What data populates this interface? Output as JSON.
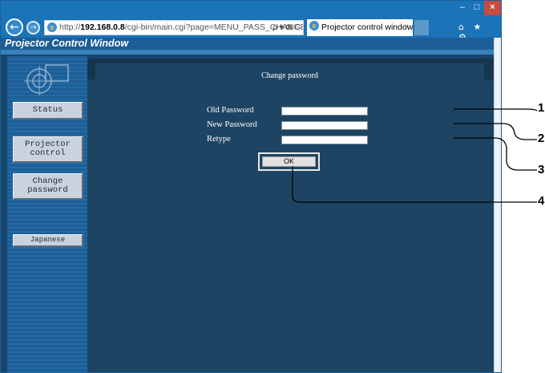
{
  "browser": {
    "url_prefix": "http://",
    "url_host": "192.168.0.8",
    "url_path": "/cgi-bin/main.cgi?page=MENU_PASS_CHANGE&lang=e",
    "address_tools": "ρ ▾ ⊠ C",
    "tab_title": "Projector control window",
    "tab_close": "×",
    "window_controls": [
      "–",
      "□",
      "×"
    ],
    "toolbar_icons": "⌂ ★ ⚙"
  },
  "page": {
    "header_title": "Projector Control Window",
    "sidebar": {
      "status_label": "Status",
      "projector_control_label": "Projector\ncontrol",
      "change_password_label": "Change\npassword",
      "japanese_label": "Japanese"
    },
    "form": {
      "title": "Change password",
      "old_password_label": "Old Password",
      "new_password_label": "New Password",
      "retype_label": "Retype",
      "old_password_value": "",
      "new_password_value": "",
      "retype_value": "",
      "ok_label": "OK"
    }
  },
  "callouts": [
    "1",
    "2",
    "3",
    "4"
  ],
  "colors": {
    "browser_chrome": "#1b73b8",
    "page_background": "#16456b",
    "panel_background": "#1d4563",
    "sidebar_button": "#c9d3de",
    "close_button": "#c74b3f"
  }
}
